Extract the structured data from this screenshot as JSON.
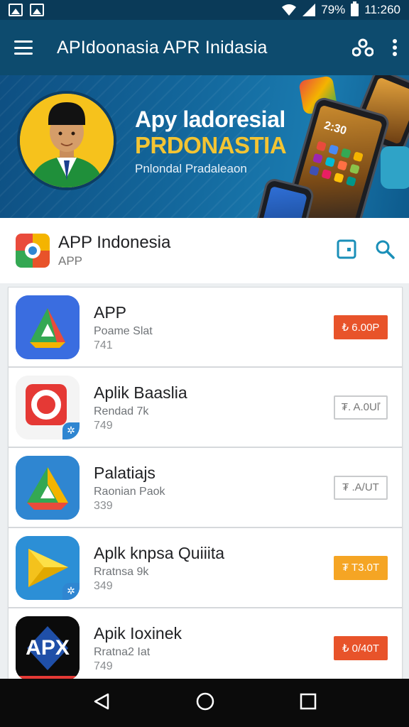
{
  "status_bar": {
    "battery": "79%",
    "time": "11:260"
  },
  "app_bar": {
    "title": "APIdoonasia  APR Inidasia"
  },
  "banner": {
    "title": "Apy ladoresial",
    "subtitle": "PRDONASTIA",
    "tagline": "Pnlondal Pradaleaon",
    "phone_clock": "2:30"
  },
  "header": {
    "title": "APP Indonesia",
    "subtitle": "APP"
  },
  "apps": [
    {
      "name": "APP",
      "desc": "Poame Slat",
      "count": "741",
      "button": "₺ 6.00P",
      "style": "red"
    },
    {
      "name": "Aplik Baaslia",
      "desc": "Rendad 7k",
      "count": "749",
      "button": "₮. A.0Uľ",
      "style": "outline"
    },
    {
      "name": "Palatiajs",
      "desc": "Raonian Paok",
      "count": "339",
      "button": "₮ .A/UT",
      "style": "outline"
    },
    {
      "name": "Aplk knpsa Quiiita",
      "desc": "Rratnsa 9k",
      "count": "349",
      "button": "₮ T3.0T",
      "style": "orange"
    },
    {
      "name": "Apik Ioxinek",
      "desc": "Rratna2 Iat",
      "count": "749",
      "button": "₺ 0/40T",
      "style": "red"
    }
  ],
  "icons": {
    "app0": "drive-triangle-icon",
    "app1": "red-o-icon",
    "app2": "drive-triangle-icon",
    "app3": "play-arrow-icon",
    "app4": "apx-logo-icon",
    "apx_text": "APX"
  },
  "colors": {
    "primary": "#0d4b6e",
    "accent_red": "#e8532a",
    "accent_orange": "#f5a524",
    "teal": "#1a8fb8"
  }
}
